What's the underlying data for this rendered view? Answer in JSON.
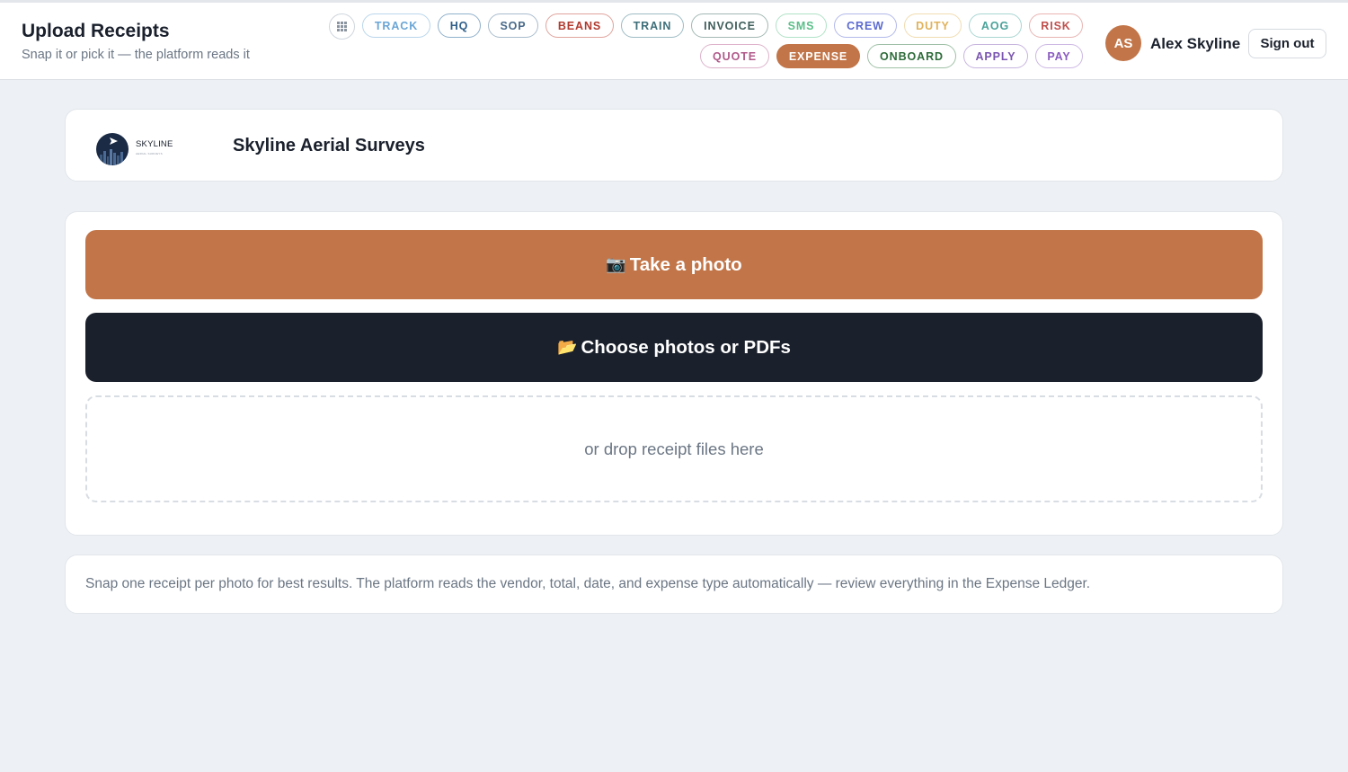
{
  "header": {
    "title": "Upload Receipts",
    "subtitle": "Snap it or pick it — the platform reads it",
    "grid_button_icon": "grid-icon",
    "nav_row1": [
      {
        "label": "TRACK",
        "color": "#6aa6d6"
      },
      {
        "label": "HQ",
        "color": "#2f5f8a"
      },
      {
        "label": "SOP",
        "color": "#4a6a8a"
      },
      {
        "label": "BEANS",
        "color": "#b03a2e"
      },
      {
        "label": "TRAIN",
        "color": "#3d6e7a"
      },
      {
        "label": "INVOICE",
        "color": "#3f5e5a"
      },
      {
        "label": "SMS",
        "color": "#5cbf8a"
      },
      {
        "label": "CREW",
        "color": "#5b6ad0"
      },
      {
        "label": "DUTY",
        "color": "#e0b25a"
      },
      {
        "label": "AOG",
        "color": "#4aa39a"
      },
      {
        "label": "RISK",
        "color": "#c0504d"
      }
    ],
    "nav_row2": [
      {
        "label": "QUOTE",
        "color": "#b05a8a"
      },
      {
        "label": "EXPENSE",
        "color": "#ffffff",
        "active": true
      },
      {
        "label": "ONBOARD",
        "color": "#2e6b3a"
      },
      {
        "label": "APPLY",
        "color": "#7a55b0"
      },
      {
        "label": "PAY",
        "color": "#8a5cc0"
      }
    ],
    "user": {
      "initials": "AS",
      "name": "Alex Skyline"
    },
    "signout_label": "Sign out"
  },
  "org": {
    "logo_text": "SKYLINE",
    "logo_subtext": "AERIAL SURVEYS",
    "name": "Skyline Aerial Surveys"
  },
  "upload": {
    "take_photo_icon": "📷",
    "take_photo_label": "Take a photo",
    "choose_icon": "📂",
    "choose_label": "Choose photos or PDFs",
    "dropzone_label": "or drop receipt files here"
  },
  "tip": "Snap one receipt per photo for best results. The platform reads the vendor, total, date, and expense type automatically — review everything in the Expense Ledger.",
  "colors": {
    "accent": "#c27548",
    "dark": "#1a202c",
    "background": "#edf0f4"
  }
}
